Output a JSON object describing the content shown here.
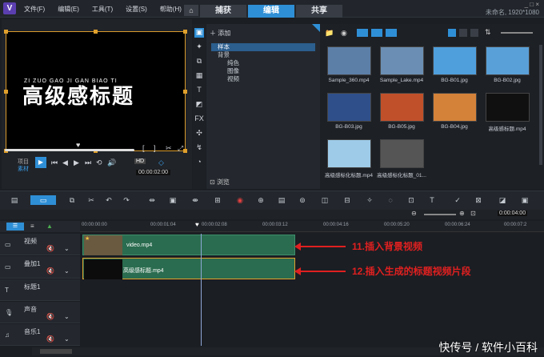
{
  "app": {
    "logo": "V",
    "project_title": "未命名, 1920*1080"
  },
  "menu": [
    "文件(F)",
    "编辑(E)",
    "工具(T)",
    "设置(S)",
    "帮助(H)"
  ],
  "tabs": [
    {
      "label": "捕获",
      "active": false
    },
    {
      "label": "编辑",
      "active": true
    },
    {
      "label": "共享",
      "active": false
    }
  ],
  "player": {
    "overlay_title": "高级感标题",
    "overlay_pinyin": "ZI  ZUO  GAO  JI  GAN  BIAO  TI",
    "mode_labels": [
      "项目",
      "素材"
    ],
    "timecode": "00:00:02:00",
    "quality": "HD"
  },
  "library": {
    "add_label": "添加",
    "browse_label": "浏览",
    "tree": [
      {
        "label": "样本",
        "selected": true,
        "level": 0
      },
      {
        "label": "背景",
        "selected": false,
        "level": 0
      },
      {
        "label": "纯色",
        "selected": false,
        "level": 1
      },
      {
        "label": "图像",
        "selected": false,
        "level": 1
      },
      {
        "label": "视频",
        "selected": false,
        "level": 1
      }
    ],
    "thumbnails": [
      {
        "caption": "Sample_360.mp4",
        "color": "#5c7fa8"
      },
      {
        "caption": "Sample_Lake.mp4",
        "color": "#6b8fb4"
      },
      {
        "caption": "BG-B01.jpg",
        "color": "#4f9fdd"
      },
      {
        "caption": "BG-B02.jpg",
        "color": "#5aa0d8"
      },
      {
        "caption": "BG-B03.jpg",
        "color": "#2f4f8a"
      },
      {
        "caption": "BG-B05.jpg",
        "color": "#c0502a"
      },
      {
        "caption": "BG-B04.jpg",
        "color": "#d4823a"
      },
      {
        "caption": "高级感标题.mp4",
        "color": "#101010"
      },
      {
        "caption": "高级感标化标题.mp4",
        "color": "#9ecbe8"
      },
      {
        "caption": "高级感标化标题_01...",
        "color": "#555555"
      }
    ]
  },
  "timeline": {
    "ruler": [
      "00:00:00:00",
      "00:00:01:04",
      "00:00:02:08",
      "00:00:03:12",
      "00:00:04:16",
      "00:00:05:20",
      "00:00:06:24",
      "00:00:07:2"
    ],
    "zoom_readout": "0:00:04:00",
    "tracks": [
      {
        "name": "视频"
      },
      {
        "name": "叠加1"
      },
      {
        "name": "标题1"
      },
      {
        "name": "声音"
      },
      {
        "name": "音乐1"
      }
    ],
    "clips": [
      {
        "label": "video.mp4"
      },
      {
        "label": "高级感标题.mp4"
      }
    ]
  },
  "annotations": [
    {
      "text": "11.插入背景视频"
    },
    {
      "text": "12.插入生成的标题视频片段"
    }
  ],
  "watermark": "快传号 / 软件小百科"
}
